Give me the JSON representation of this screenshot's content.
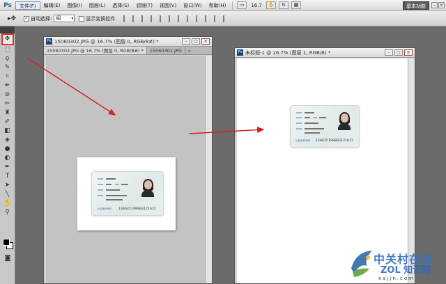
{
  "app": {
    "logo": "Ps"
  },
  "menubar": {
    "items": [
      "文件(F)",
      "编辑(E)",
      "图像(I)",
      "图层(L)",
      "选择(S)",
      "滤镜(T)",
      "视图(V)",
      "窗口(W)",
      "帮助(H)"
    ],
    "zoom": "16.7",
    "workspace": "基本功能"
  },
  "optionsbar": {
    "auto_select_label": "自动选择:",
    "auto_select_checked": true,
    "auto_select_value": "组",
    "transform_label": "显示变换控件",
    "transform_checked": false
  },
  "doc1": {
    "title": "15060302.JPG @ 16.7% (图层 0, RGB/8#) *",
    "tabs": [
      "15060302.JPG @ 16.7% (图层 0, RGB/8#) *",
      "15060301.JPG"
    ]
  },
  "doc2": {
    "title": "未标题-1 @ 16.7% (图层 1, RGB/8) *"
  },
  "card": {
    "label": "公民身份号码",
    "number": "130635198803121622"
  },
  "watermark": {
    "line1": "中关村在线",
    "line2": "ZOL 知识网",
    "url": "xajjn.com"
  },
  "colors": {
    "arrow": "#d42020",
    "tool_highlight": "#e03030"
  },
  "icons": [
    "move-tool-icon",
    "marquee-tool-icon",
    "lasso-tool-icon",
    "quick-select-icon",
    "crop-tool-icon",
    "eyedropper-icon",
    "healing-brush-icon",
    "brush-tool-icon",
    "clone-stamp-icon",
    "history-brush-icon",
    "eraser-icon",
    "gradient-icon",
    "blur-icon",
    "dodge-icon",
    "pen-tool-icon",
    "type-tool-icon",
    "path-select-icon",
    "shape-tool-icon",
    "hand-tool-icon",
    "zoom-tool-icon"
  ]
}
